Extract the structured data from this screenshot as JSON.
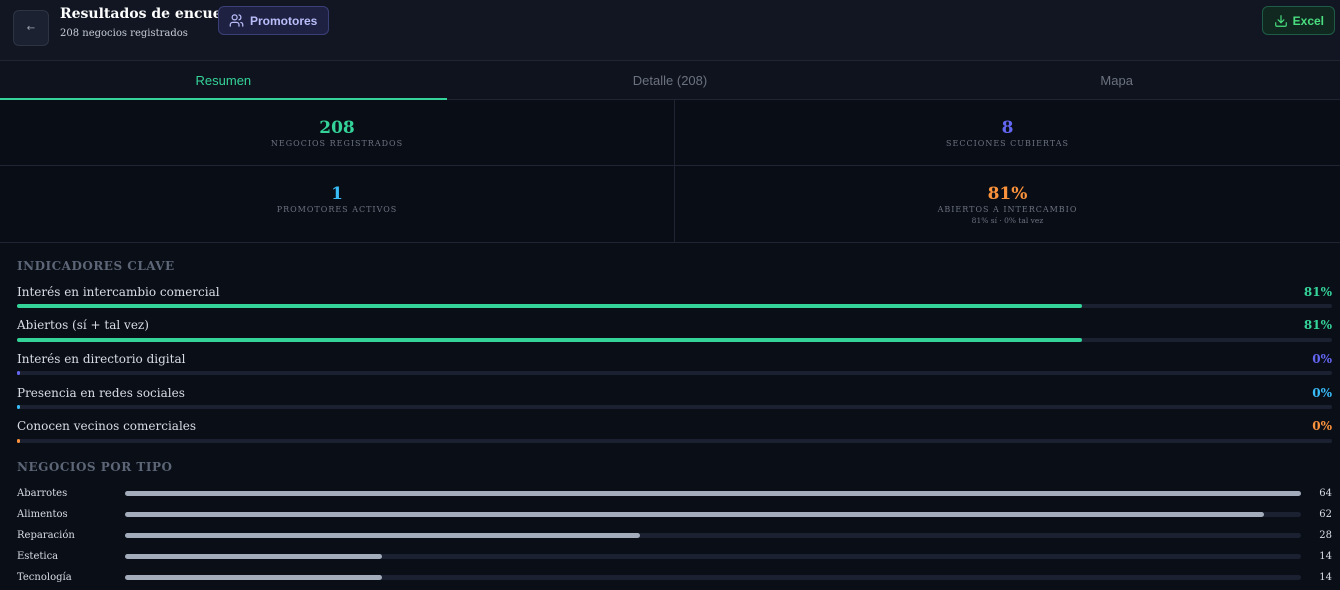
{
  "header": {
    "title": "Resultados de encuestas",
    "subtitle": "208 negocios registrados",
    "back_icon": "arrow-left-icon",
    "promoters_label": "Promotores",
    "promoters_icon": "users-icon",
    "excel_label": "Excel",
    "excel_icon": "download-icon"
  },
  "tabs": [
    {
      "label": "Resumen",
      "active": true
    },
    {
      "label": "Detalle (208)",
      "active": false
    },
    {
      "label": "Mapa",
      "active": false
    }
  ],
  "stats": [
    {
      "value": "208",
      "label": "NEGOCIOS REGISTRADOS",
      "color": "#34d399"
    },
    {
      "value": "8",
      "label": "SECCIONES CUBIERTAS",
      "color": "#6366f1"
    },
    {
      "value": "1",
      "label": "PROMOTORES ACTIVOS",
      "color": "#38bdf8"
    },
    {
      "value": "81%",
      "label": "ABIERTOS A INTERCAMBIO",
      "note": "81% sí · 0% tal vez",
      "color": "#fb923c"
    }
  ],
  "indicators": {
    "title": "INDICADORES CLAVE",
    "items": [
      {
        "label": "Interés en intercambio comercial",
        "value_text": "81%",
        "percent": 81,
        "color": "#34d399"
      },
      {
        "label": "Abiertos (sí + tal vez)",
        "value_text": "81%",
        "percent": 81,
        "color": "#34d399"
      },
      {
        "label": "Interés en directorio digital",
        "value_text": "0%",
        "percent": 0,
        "color": "#6366f1"
      },
      {
        "label": "Presencia en redes sociales",
        "value_text": "0%",
        "percent": 0,
        "color": "#38bdf8"
      },
      {
        "label": "Conocen vecinos comerciales",
        "value_text": "0%",
        "percent": 0,
        "color": "#fb923c"
      }
    ]
  },
  "business_types": {
    "title": "NEGOCIOS POR TIPO",
    "max": 64,
    "items": [
      {
        "label": "Abarrotes",
        "count": 64
      },
      {
        "label": "Alimentos",
        "count": 62
      },
      {
        "label": "Reparación",
        "count": 28
      },
      {
        "label": "Estetica",
        "count": 14
      },
      {
        "label": "Tecnología",
        "count": 14
      }
    ]
  }
}
